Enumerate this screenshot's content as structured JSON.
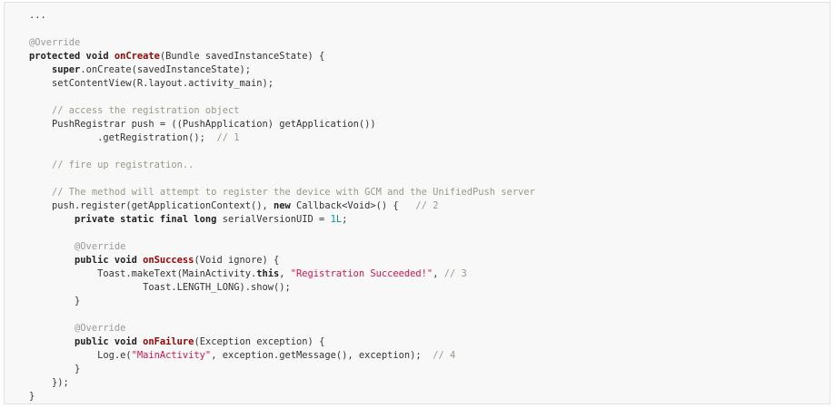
{
  "code_block": {
    "lines": [
      [
        {
          "t": "...",
          "c": "tx"
        }
      ],
      [
        {
          "t": "",
          "c": "tx"
        }
      ],
      [
        {
          "t": "@Override",
          "c": "an"
        }
      ],
      [
        {
          "t": "protected void ",
          "c": "kw"
        },
        {
          "t": "onCreate",
          "c": "fn"
        },
        {
          "t": "(Bundle savedInstanceState) {",
          "c": "tx"
        }
      ],
      [
        {
          "t": "    ",
          "c": "tx"
        },
        {
          "t": "super",
          "c": "kw"
        },
        {
          "t": ".onCreate(savedInstanceState);",
          "c": "tx"
        }
      ],
      [
        {
          "t": "    setContentView(R.layout.activity_main);",
          "c": "tx"
        }
      ],
      [
        {
          "t": "",
          "c": "tx"
        }
      ],
      [
        {
          "t": "    ",
          "c": "tx"
        },
        {
          "t": "// access the registration object",
          "c": "cm"
        }
      ],
      [
        {
          "t": "    PushRegistrar push = ((PushApplication) getApplication())",
          "c": "tx"
        }
      ],
      [
        {
          "t": "            .getRegistration();  ",
          "c": "tx"
        },
        {
          "t": "// 1",
          "c": "cm"
        }
      ],
      [
        {
          "t": "",
          "c": "tx"
        }
      ],
      [
        {
          "t": "    ",
          "c": "tx"
        },
        {
          "t": "// fire up registration..",
          "c": "cm"
        }
      ],
      [
        {
          "t": "",
          "c": "tx"
        }
      ],
      [
        {
          "t": "    ",
          "c": "tx"
        },
        {
          "t": "// The method will attempt to register the device with GCM and the UnifiedPush server",
          "c": "cm"
        }
      ],
      [
        {
          "t": "    push.register(getApplicationContext(), ",
          "c": "tx"
        },
        {
          "t": "new",
          "c": "kw"
        },
        {
          "t": " Callback<Void>() {   ",
          "c": "tx"
        },
        {
          "t": "// 2",
          "c": "cm"
        }
      ],
      [
        {
          "t": "        ",
          "c": "tx"
        },
        {
          "t": "private static final long",
          "c": "kw"
        },
        {
          "t": " serialVersionUID = ",
          "c": "tx"
        },
        {
          "t": "1L",
          "c": "num"
        },
        {
          "t": ";",
          "c": "tx"
        }
      ],
      [
        {
          "t": "",
          "c": "tx"
        }
      ],
      [
        {
          "t": "        ",
          "c": "tx"
        },
        {
          "t": "@Override",
          "c": "an"
        }
      ],
      [
        {
          "t": "        ",
          "c": "tx"
        },
        {
          "t": "public void ",
          "c": "kw"
        },
        {
          "t": "onSuccess",
          "c": "fn"
        },
        {
          "t": "(Void ignore) {",
          "c": "tx"
        }
      ],
      [
        {
          "t": "            Toast.makeText(MainActivity.",
          "c": "tx"
        },
        {
          "t": "this",
          "c": "kw"
        },
        {
          "t": ", ",
          "c": "tx"
        },
        {
          "t": "\"Registration Succeeded!\"",
          "c": "str"
        },
        {
          "t": ", ",
          "c": "tx"
        },
        {
          "t": "// 3",
          "c": "cm"
        }
      ],
      [
        {
          "t": "                    Toast.LENGTH_LONG).show();",
          "c": "tx"
        }
      ],
      [
        {
          "t": "        }",
          "c": "tx"
        }
      ],
      [
        {
          "t": "",
          "c": "tx"
        }
      ],
      [
        {
          "t": "        ",
          "c": "tx"
        },
        {
          "t": "@Override",
          "c": "an"
        }
      ],
      [
        {
          "t": "        ",
          "c": "tx"
        },
        {
          "t": "public void ",
          "c": "kw"
        },
        {
          "t": "onFailure",
          "c": "fn"
        },
        {
          "t": "(Exception exception) {",
          "c": "tx"
        }
      ],
      [
        {
          "t": "            Log.e(",
          "c": "tx"
        },
        {
          "t": "\"MainActivity\"",
          "c": "str"
        },
        {
          "t": ", exception.getMessage(), exception);  ",
          "c": "tx"
        },
        {
          "t": "// 4",
          "c": "cm"
        }
      ],
      [
        {
          "t": "        }",
          "c": "tx"
        }
      ],
      [
        {
          "t": "    });",
          "c": "tx"
        }
      ],
      [
        {
          "t": "}",
          "c": "tx"
        }
      ]
    ]
  }
}
